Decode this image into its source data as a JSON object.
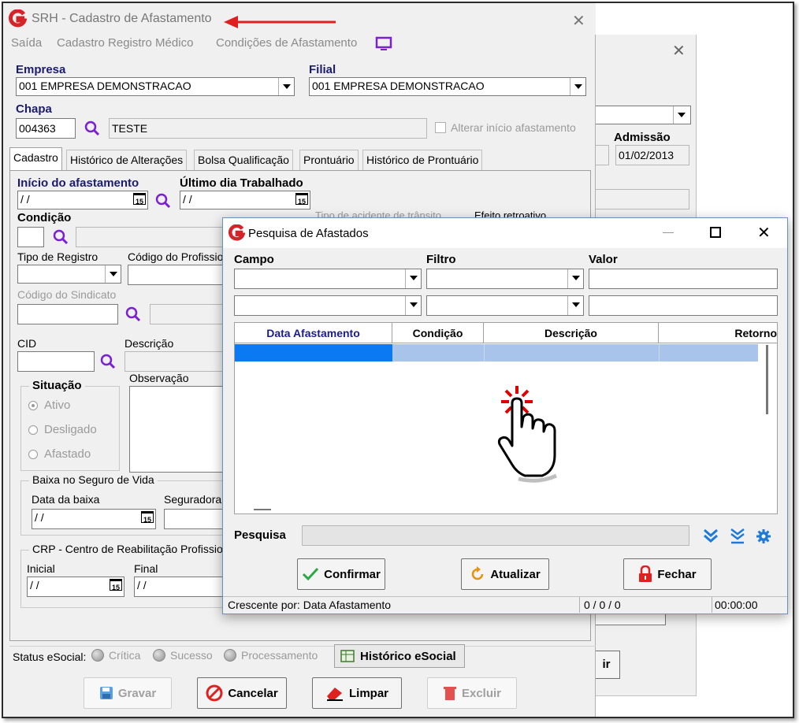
{
  "main_window": {
    "title": "SRH - Cadastro de Afastamento",
    "menu": [
      "Saída",
      "Cadastro Registro Médico",
      "Condições de Afastamento"
    ],
    "empresa_label": "Empresa",
    "empresa_value": "001 EMPRESA DEMONSTRACAO",
    "filial_label": "Filial",
    "filial_value": "001 EMPRESA DEMONSTRACAO",
    "chapa_label": "Chapa",
    "chapa_value": "004363",
    "chapa_name": "TESTE",
    "alterar_inicio_label": "Alterar início afastamento",
    "tabs": [
      "Cadastro",
      "Histórico de Alterações",
      "Bolsa Qualificação",
      "Prontuário",
      "Histórico de Prontuário"
    ],
    "inicio_label": "Início do afastamento",
    "inicio_value": "/ /",
    "ultimo_dia_label": "Último dia Trabalhado",
    "ultimo_dia_value": "/ /",
    "condicao_label": "Condição",
    "tipo_acidente_label": "Tipo de acidente de trânsito",
    "efeito_retroativo_label": "Efeito retroativo",
    "tipo_registro_label": "Tipo de Registro",
    "codigo_profissional_label": "Código do Profissio",
    "codigo_sindicato_label": "Código do Sindicato",
    "cid_label": "CID",
    "descricao_label": "Descrição",
    "situacao_label": "Situação",
    "situacao_options": [
      "Ativo",
      "Desligado",
      "Afastado"
    ],
    "observacao_label": "Observação",
    "baixa_seguro_label": "Baixa no Seguro de Vida",
    "data_baixa_label": "Data da baixa",
    "data_baixa_value": "/ /",
    "seguradora_label": "Seguradora",
    "crp_label": "CRP - Centro de Reabilitação Profissio",
    "inicial_label": "Inicial",
    "inicial_value": "/ /",
    "final_label": "Final",
    "final_value": "/ /",
    "status_esocial_label": "Status eSocial:",
    "status_items": [
      "Crítica",
      "Sucesso",
      "Processamento"
    ],
    "historico_esocial_label": "Histórico eSocial",
    "buttons": {
      "gravar": "Gravar",
      "cancelar": "Cancelar",
      "limpar": "Limpar",
      "excluir": "Excluir"
    },
    "cal_day": "15"
  },
  "back_window": {
    "admissao_label": "Admissão",
    "admissao_value": "01/02/2013",
    "partial_text": "ir"
  },
  "dialog": {
    "title": "Pesquisa de Afastados",
    "campo_label": "Campo",
    "filtro_label": "Filtro",
    "valor_label": "Valor",
    "columns": [
      "Data Afastamento",
      "Condição",
      "Descrição",
      "Retorno"
    ],
    "pesquisa_label": "Pesquisa",
    "buttons": {
      "confirmar": "Confirmar",
      "atualizar": "Atualizar",
      "fechar": "Fechar"
    },
    "status": {
      "sort": "Crescente por: Data Afastamento",
      "counts": "0 / 0 / 0",
      "time": "00:00:00"
    }
  },
  "colors": {
    "accent_purple": "#7b1fd1",
    "brand_red": "#d4242a",
    "selection_blue": "#0a79f2",
    "selection_light": "#a9c4ea",
    "label_blue": "#1c1c6e"
  }
}
